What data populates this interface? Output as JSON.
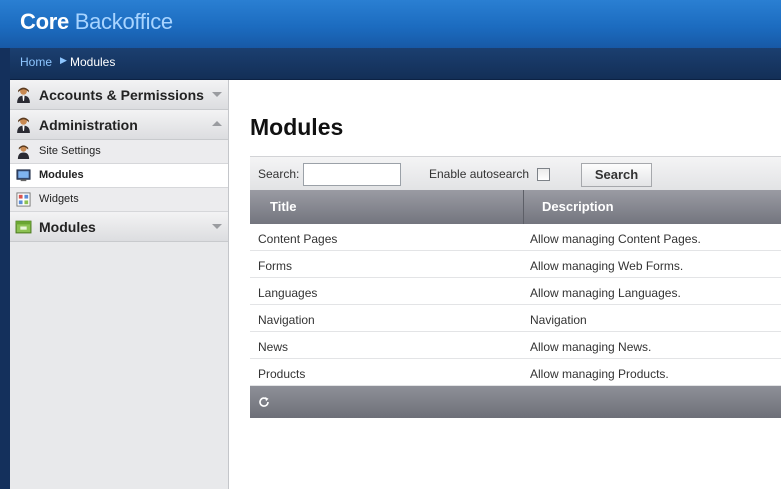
{
  "header": {
    "logo_bold": "Core",
    "logo_light": "Backoffice"
  },
  "breadcrumb": {
    "home": "Home",
    "current": "Modules"
  },
  "sidebar": {
    "sections": [
      {
        "label": "Accounts & Permissions",
        "icon": "user-icon",
        "expanded": false
      },
      {
        "label": "Administration",
        "icon": "user-icon",
        "expanded": true,
        "items": [
          {
            "label": "Site Settings",
            "icon": "user-icon",
            "active": false
          },
          {
            "label": "Modules",
            "icon": "monitor-icon",
            "active": true
          },
          {
            "label": "Widgets",
            "icon": "widget-grid-icon",
            "active": false
          }
        ]
      },
      {
        "label": "Modules",
        "icon": "module-box-icon",
        "expanded": false
      }
    ]
  },
  "main": {
    "title": "Modules",
    "search": {
      "label": "Search:",
      "value": "",
      "autosearch_label": "Enable autosearch",
      "autosearch_checked": false,
      "button": "Search"
    },
    "columns": [
      "Title",
      "Description"
    ],
    "rows": [
      {
        "title": "Content Pages",
        "description": "Allow managing Content Pages."
      },
      {
        "title": "Forms",
        "description": "Allow managing Web Forms."
      },
      {
        "title": "Languages",
        "description": "Allow managing Languages."
      },
      {
        "title": "Navigation",
        "description": "Navigation"
      },
      {
        "title": "News",
        "description": "Allow managing News."
      },
      {
        "title": "Products",
        "description": "Allow managing Products."
      }
    ],
    "footer_icon": "refresh-icon"
  },
  "colors": {
    "header": "#1c6cc0",
    "frame": "#14305c",
    "grid_header": "#73757e"
  }
}
